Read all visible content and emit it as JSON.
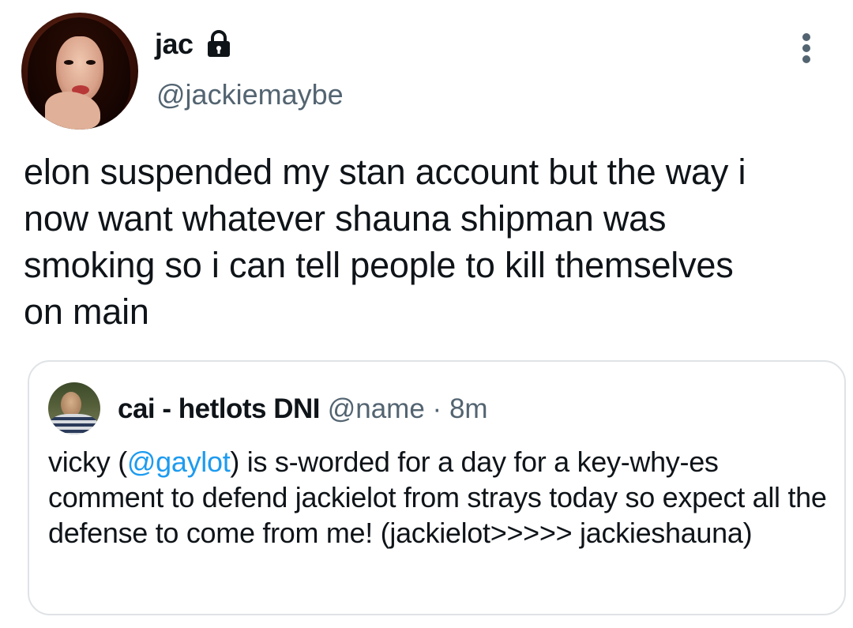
{
  "tweet": {
    "display_name": "jac",
    "handle": "@jackiemaybe",
    "text": "elon suspended my stan account but the way i\nnow  want whatever shauna shipman was\nsmoking so i can tell people to kill themselves\non main"
  },
  "quoted_tweet": {
    "display_name": "cai - hetlots DNI",
    "handle": "@name",
    "separator": "·",
    "time": "8m",
    "text_before_mention": "vicky (",
    "mention": "@gaylot",
    "text_after_mention": ")  is s-worded for a day  for a key-why-es comment to defend jackielot from strays today  so expect all the defense to come from me! (jackielot>>>>> jackieshauna)"
  },
  "colors": {
    "text": "#0f1419",
    "secondary": "#536471",
    "link": "#1d9bf0",
    "border": "#dfe3e6"
  },
  "icons": {
    "lock": "lock-icon",
    "more": "more-vertical-icon"
  }
}
